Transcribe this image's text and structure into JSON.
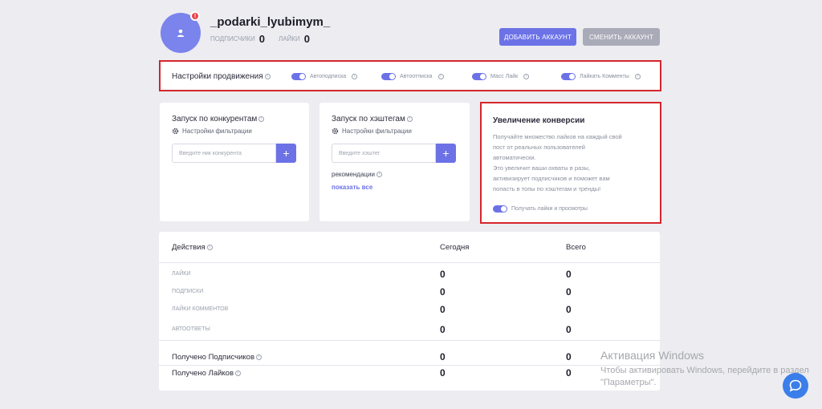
{
  "profile": {
    "username": "_podarki_lyubimym_",
    "notification_badge": "!",
    "followers_label": "подписчики",
    "followers_count": "0",
    "likes_label": "лайки",
    "likes_count": "0"
  },
  "header_buttons": {
    "add_account": "ДОБАВИТЬ АККАУНТ",
    "switch_account": "СМЕНИТЬ АККАУНТ"
  },
  "promotion": {
    "title": "Настройки продвижения",
    "toggles": [
      {
        "label": "Автоподписка",
        "on": true
      },
      {
        "label": "Автоотписка",
        "on": true
      },
      {
        "label": "Масс Лайк",
        "on": true
      },
      {
        "label": "Лайкать Комменты",
        "on": true
      }
    ]
  },
  "competitors": {
    "title": "Запуск по конкурентам",
    "filter_label": "Настройки фильтрации",
    "input_placeholder": "Введите ник конкурента",
    "add_label": "+"
  },
  "hashtags": {
    "title": "Запуск по хэштегам",
    "filter_label": "Настройки фильтрации",
    "input_placeholder": "Введите хэштег",
    "add_label": "+",
    "recommendations_label": "рекомендации",
    "show_all_link": "показать все"
  },
  "conversion": {
    "title": "Увеличение конверсии",
    "text_lines": [
      "Получайте множество лайков на каждый свой",
      "пост от реальных пользователей",
      "автоматически.",
      "Это увеличит ваши охваты в разы,",
      "активизирует подписчиков и поможет вам",
      "попасть в топы по хэштегам и тренды!"
    ],
    "toggle_label": "Получать лайки и просмотры"
  },
  "actions_table": {
    "header_actions": "Действия",
    "header_today": "Сегодня",
    "header_total": "Всего",
    "rows": [
      {
        "label": "ЛАЙКИ",
        "today": "0",
        "total": "0"
      },
      {
        "label": "ПОДПИСКИ",
        "today": "0",
        "total": "0"
      },
      {
        "label": "ЛАЙКИ КОММЕНТОВ",
        "today": "0",
        "total": "0"
      },
      {
        "label": "АВТООТВЕТЫ",
        "today": "0",
        "total": "0"
      }
    ],
    "received_rows": [
      {
        "label": "Получено Подписчиков",
        "today": "0",
        "total": "0"
      },
      {
        "label": "Получено Лайков",
        "today": "0",
        "total": "0"
      }
    ]
  },
  "watermark": {
    "line1": "Активация Windows",
    "line2": "Чтобы активировать Windows, перейдите в раздел \"Параметры\"."
  },
  "colors": {
    "accent": "#6c72e6",
    "highlight_border": "#d6262c",
    "background": "#ececf1"
  }
}
